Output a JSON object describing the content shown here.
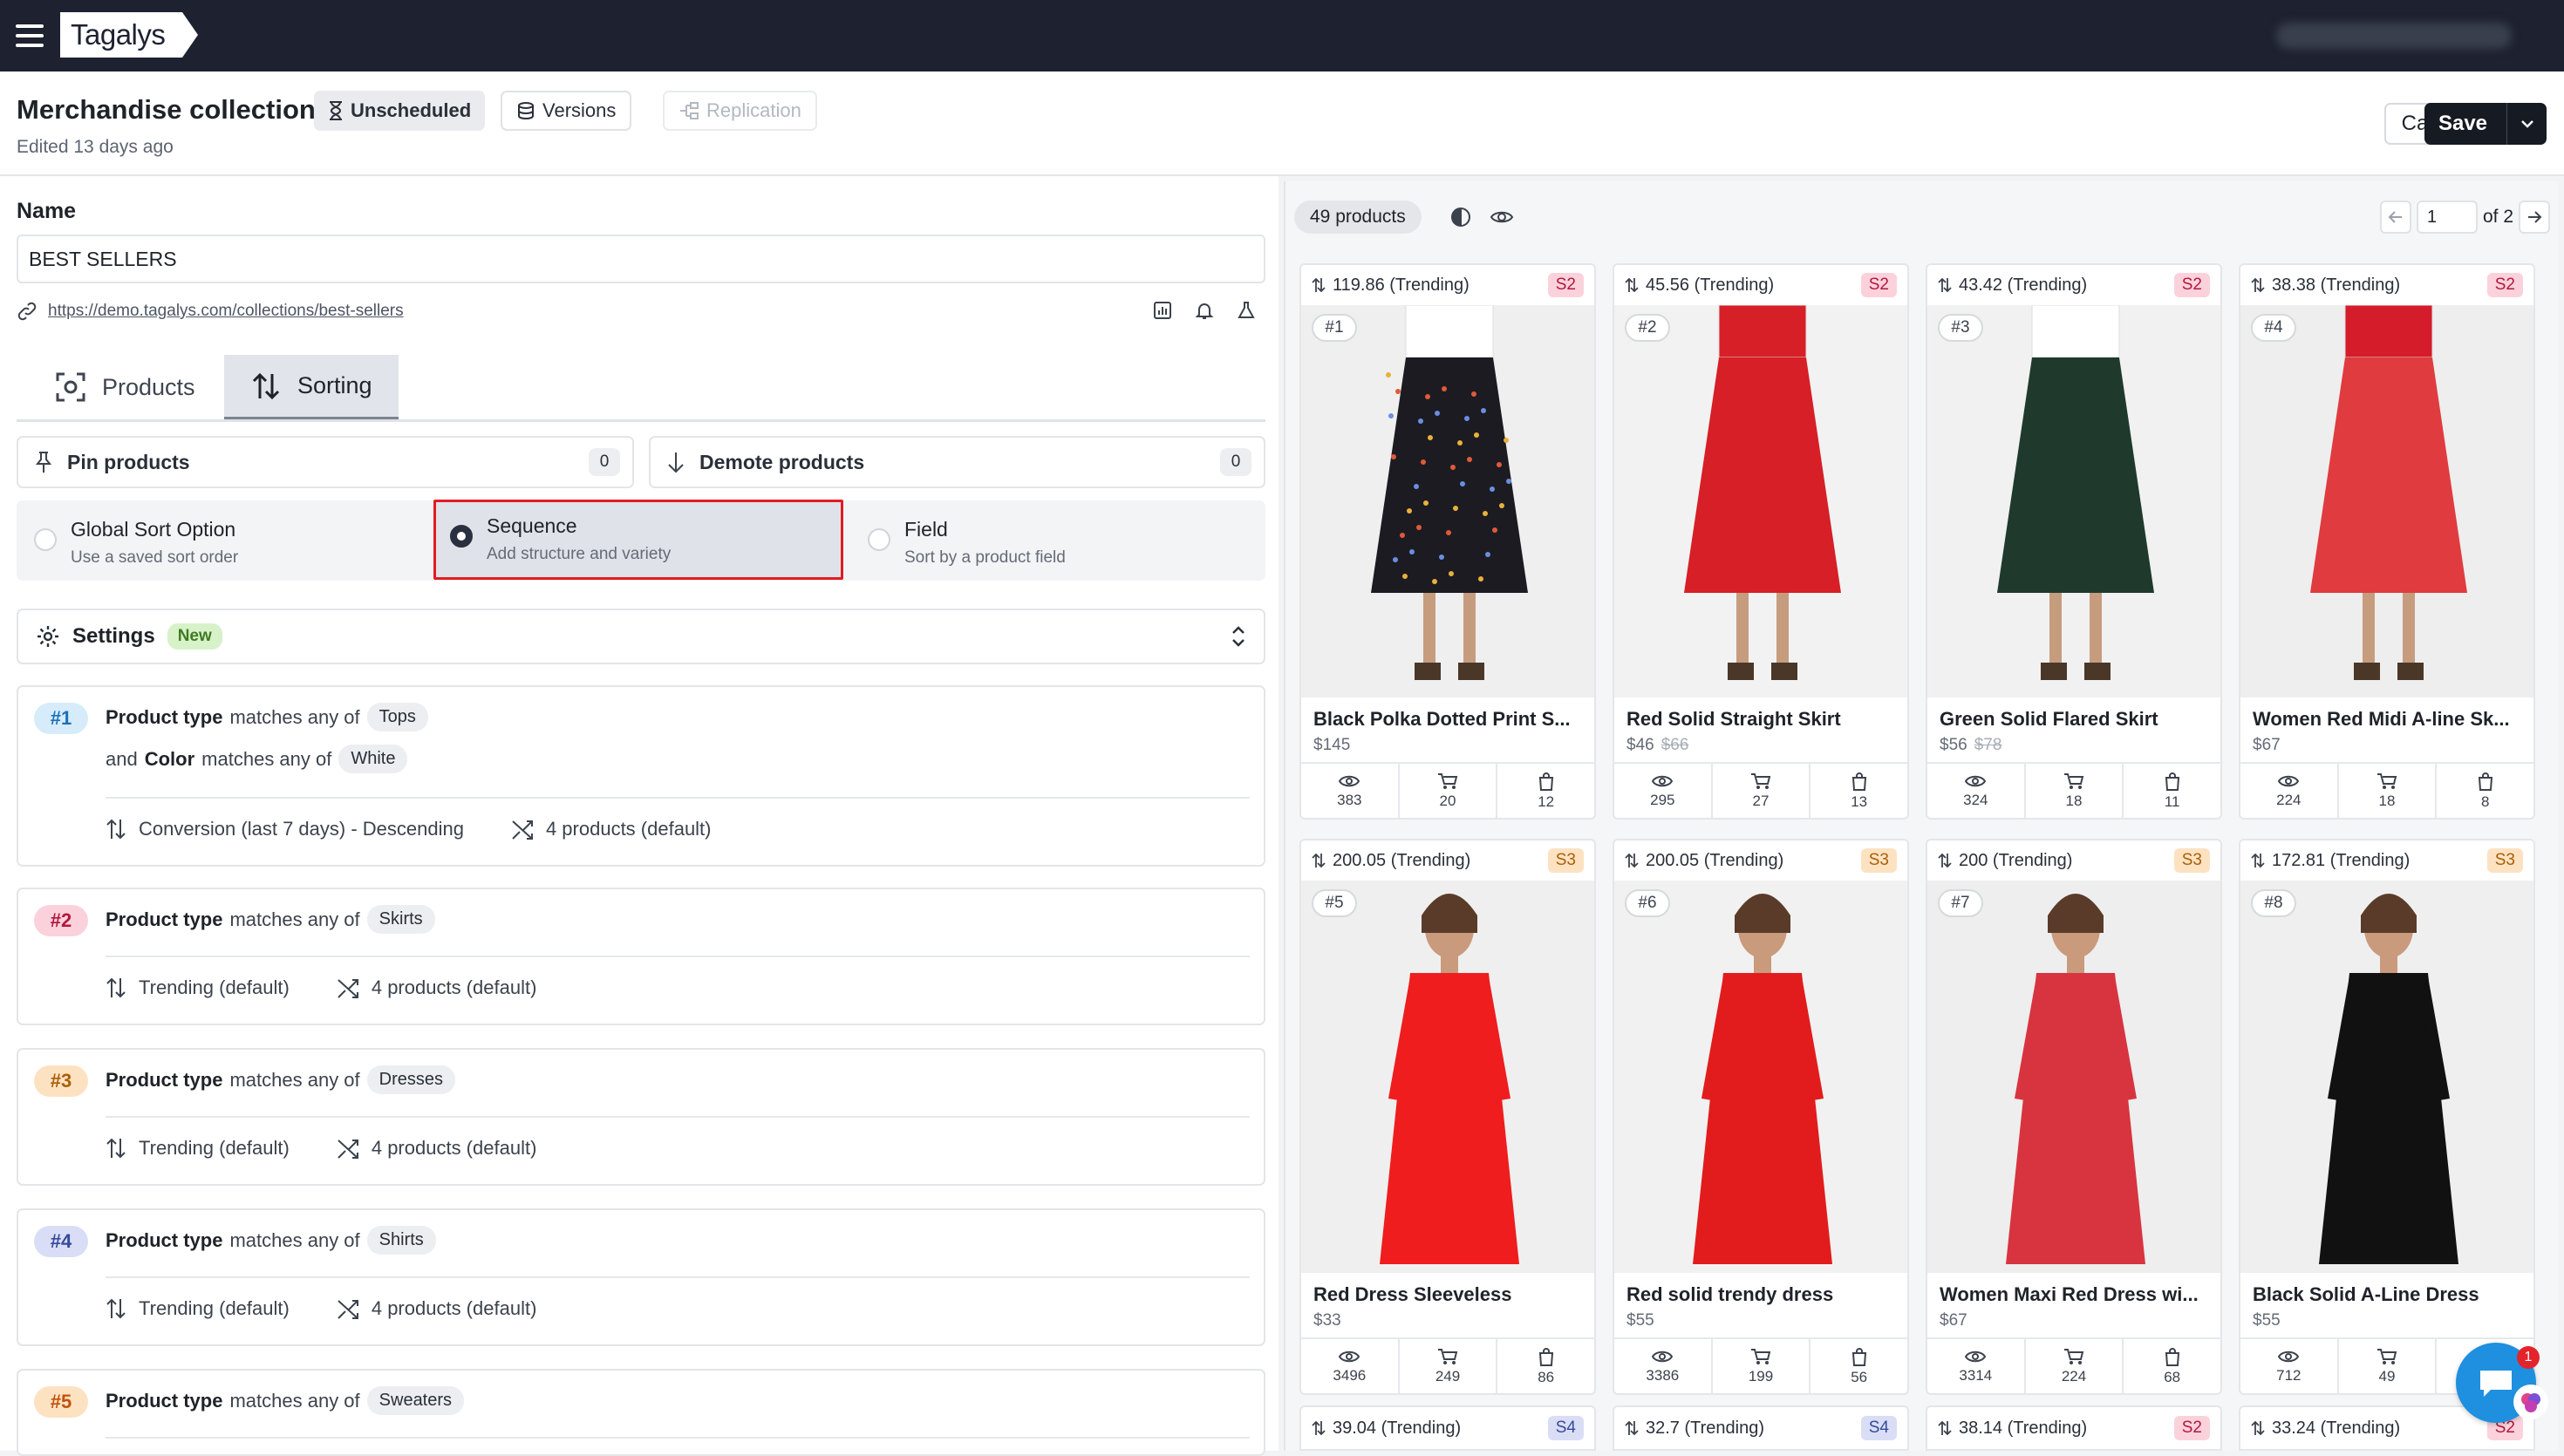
{
  "topbar": {
    "logo": "Tagalys"
  },
  "header": {
    "title": "Merchandise collection",
    "subtitle": "Edited 13 days ago",
    "status": "Unscheduled",
    "versions": "Versions",
    "replication": "Replication",
    "cancel": "Cancel",
    "save": "Save"
  },
  "form": {
    "name_label": "Name",
    "name_value": "BEST SELLERS",
    "link": "https://demo.tagalys.com/collections/best-sellers"
  },
  "tabs": [
    {
      "label": "Products"
    },
    {
      "label": "Sorting"
    }
  ],
  "pin": {
    "label": "Pin products",
    "count": "0"
  },
  "demote": {
    "label": "Demote products",
    "count": "0"
  },
  "sort_options": [
    {
      "title": "Global Sort Option",
      "sub": "Use a saved sort order",
      "selected": false
    },
    {
      "title": "Sequence",
      "sub": "Add structure and variety",
      "selected": true
    },
    {
      "title": "Field",
      "sub": "Sort by a product field",
      "selected": false
    }
  ],
  "settings": {
    "label": "Settings",
    "badge": "New"
  },
  "rules": [
    {
      "num": "#1",
      "c1_field": "Product type",
      "c1_op": "matches any of",
      "c1_val": "Tops",
      "c2_pre": "and",
      "c2_field": "Color",
      "c2_op": "matches any of",
      "c2_val": "White",
      "sort": "Conversion (last 7 days) - Descending",
      "count": "4 products (default)"
    },
    {
      "num": "#2",
      "c1_field": "Product type",
      "c1_op": "matches any of",
      "c1_val": "Skirts",
      "sort": "Trending (default)",
      "count": "4 products (default)"
    },
    {
      "num": "#3",
      "c1_field": "Product type",
      "c1_op": "matches any of",
      "c1_val": "Dresses",
      "sort": "Trending (default)",
      "count": "4 products (default)"
    },
    {
      "num": "#4",
      "c1_field": "Product type",
      "c1_op": "matches any of",
      "c1_val": "Shirts",
      "sort": "Trending (default)",
      "count": "4 products (default)"
    },
    {
      "num": "#5",
      "c1_field": "Product type",
      "c1_op": "matches any of",
      "c1_val": "Sweaters"
    }
  ],
  "products_panel": {
    "count": "49 products",
    "page": "1",
    "of": "of 2"
  },
  "products": [
    {
      "score": "119.86 (Trending)",
      "seq": "S2",
      "pos": "#1",
      "name": "Black Polka Dotted Print S...",
      "price": "$145",
      "old": "",
      "views": "383",
      "carts": "20",
      "orders": "12"
    },
    {
      "score": "45.56 (Trending)",
      "seq": "S2",
      "pos": "#2",
      "name": "Red Solid Straight Skirt",
      "price": "$46",
      "old": "$66",
      "views": "295",
      "carts": "27",
      "orders": "13"
    },
    {
      "score": "43.42 (Trending)",
      "seq": "S2",
      "pos": "#3",
      "name": "Green Solid Flared Skirt",
      "price": "$56",
      "old": "$78",
      "views": "324",
      "carts": "18",
      "orders": "11"
    },
    {
      "score": "38.38 (Trending)",
      "seq": "S2",
      "pos": "#4",
      "name": "Women Red Midi A-line Sk...",
      "price": "$67",
      "old": "",
      "views": "224",
      "carts": "18",
      "orders": "8"
    },
    {
      "score": "200.05 (Trending)",
      "seq": "S3",
      "pos": "#5",
      "name": "Red Dress Sleeveless",
      "price": "$33",
      "old": "",
      "views": "3496",
      "carts": "249",
      "orders": "86"
    },
    {
      "score": "200.05 (Trending)",
      "seq": "S3",
      "pos": "#6",
      "name": "Red solid trendy dress",
      "price": "$55",
      "old": "",
      "views": "3386",
      "carts": "199",
      "orders": "56"
    },
    {
      "score": "200 (Trending)",
      "seq": "S3",
      "pos": "#7",
      "name": "Women Maxi Red Dress wi...",
      "price": "$67",
      "old": "",
      "views": "3314",
      "carts": "224",
      "orders": "68"
    },
    {
      "score": "172.81 (Trending)",
      "seq": "S3",
      "pos": "#8",
      "name": "Black Solid A-Line Dress",
      "price": "$55",
      "old": "",
      "views": "712",
      "carts": "49",
      "orders": ""
    }
  ],
  "next_row": [
    {
      "score": "39.04 (Trending)",
      "seq": "S4"
    },
    {
      "score": "32.7 (Trending)",
      "seq": "S4"
    },
    {
      "score": "38.14 (Trending)",
      "seq": "S2"
    },
    {
      "score": "33.24 (Trending)",
      "seq": "S2"
    }
  ],
  "chat": {
    "badge": "1"
  },
  "colors": {
    "topbar": "#1d2130",
    "highlight": "#e31b23",
    "save": "#161a22"
  }
}
